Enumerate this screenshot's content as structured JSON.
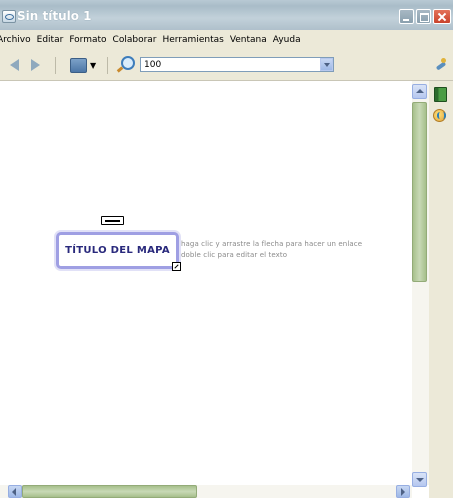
{
  "window": {
    "title": "Sin título 1"
  },
  "menu": {
    "items": [
      "Archivo",
      "Editar",
      "Formato",
      "Colaborar",
      "Herramientas",
      "Ventana",
      "Ayuda"
    ]
  },
  "toolbar": {
    "zoom_value": "100"
  },
  "canvas": {
    "node_label": "TÍTULO DEL MAPA",
    "hint_line_1": "haga clic y arrastre la flecha para hacer un enlace",
    "hint_line_2": "doble clic para editar el texto"
  },
  "colors": {
    "node_border": "#9f9fe3",
    "node_text": "#29297c",
    "scrollbar_thumb": "#a7c08c"
  },
  "icons": [
    "app-icon",
    "minimize-icon",
    "maximize-icon",
    "close-icon",
    "back-arrow-icon",
    "forward-arrow-icon",
    "display-icon",
    "zoom-icon",
    "tool-icon",
    "book-icon",
    "globe-icon"
  ]
}
